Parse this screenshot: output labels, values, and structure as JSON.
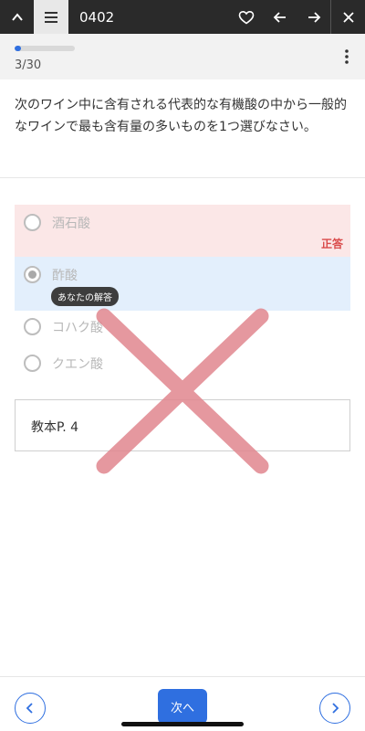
{
  "topbar": {
    "title": "0402",
    "icons": [
      "chevron-up-icon",
      "menu-icon",
      "heart-icon",
      "arrow-left-icon",
      "arrow-right-icon",
      "close-icon"
    ]
  },
  "progress": {
    "text": "3/30",
    "fraction": 0.1
  },
  "question": {
    "text": "次のワイン中に含有される代表的な有機酸の中から一般的なワインで最も含有量の多いものを1つ選びなさい。"
  },
  "options": [
    {
      "label": "酒石酸",
      "state": "correct",
      "tag": "正答"
    },
    {
      "label": "酢酸",
      "state": "selected",
      "tag": "あなたの解答"
    },
    {
      "label": "コハク酸",
      "state": "normal"
    },
    {
      "label": "クエン酸",
      "state": "normal"
    }
  ],
  "reference": {
    "text": "教本P. 4"
  },
  "footer": {
    "next_label": "次へ"
  },
  "colors": {
    "accent": "#2f6fe0",
    "correct_bg": "#fbe7e7",
    "selected_bg": "#e3effc",
    "correct_tag": "#d94a4a",
    "wrong_mark": "#e0868e"
  }
}
